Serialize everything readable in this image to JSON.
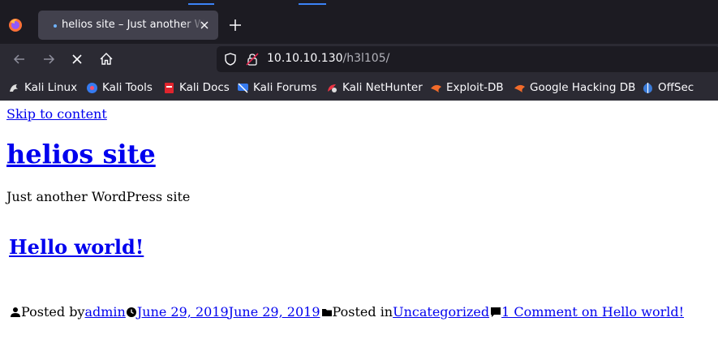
{
  "browser": {
    "tab": {
      "title": "helios site – Just another WordPress site"
    },
    "address": {
      "host": "10.10.10.130",
      "path": "/h3l105/"
    },
    "bookmarks": [
      {
        "label": "Kali Linux",
        "icon": "kali-dragon-icon"
      },
      {
        "label": "Kali Tools",
        "icon": "kali-tools-icon"
      },
      {
        "label": "Kali Docs",
        "icon": "kali-docs-icon"
      },
      {
        "label": "Kali Forums",
        "icon": "kali-forums-icon"
      },
      {
        "label": "Kali NetHunter",
        "icon": "kali-nethunter-icon"
      },
      {
        "label": "Exploit-DB",
        "icon": "exploit-db-icon"
      },
      {
        "label": "Google Hacking DB",
        "icon": "ghdb-icon"
      },
      {
        "label": "OffSec",
        "icon": "offsec-icon"
      }
    ],
    "colors": {
      "chrome_dark": "#1c1b22",
      "chrome": "#2b2a33",
      "tab_active": "#42414d",
      "link": "#0000ee"
    }
  },
  "page": {
    "skip_link": "Skip to content",
    "site_title": "helios site",
    "tagline": "Just another WordPress site",
    "post": {
      "title": "Hello world!",
      "posted_by_label": "Posted by",
      "author": "admin",
      "date_published": "June 29, 2019",
      "date_updated": "June 29, 2019",
      "posted_in_label": "Posted in",
      "category": "Uncategorized",
      "comments": "1 Comment on Hello world!"
    }
  }
}
